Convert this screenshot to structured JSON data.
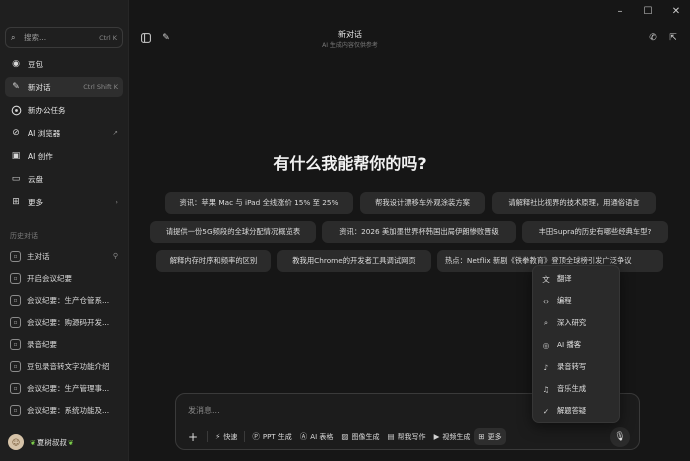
{
  "window": {
    "controls": [
      {
        "name": "minimize-button",
        "glyph": "–"
      },
      {
        "name": "maximize-button",
        "glyph": "☐"
      },
      {
        "name": "close-button",
        "glyph": "✕"
      }
    ]
  },
  "sidebar": {
    "search": {
      "placeholder": "搜索...",
      "shortcut": "Ctrl K"
    },
    "nav": [
      {
        "name": "nav-doubao",
        "icon": "doubao-logo-icon",
        "glyph": "◉",
        "label": "豆包",
        "right": ""
      },
      {
        "name": "nav-new-chat",
        "icon": "edit-icon",
        "glyph": "✎",
        "label": "新对话",
        "right": "Ctrl Shift K",
        "active": true
      },
      {
        "name": "nav-new-task",
        "icon": "task-icon",
        "glyph": "",
        "label": "新办公任务",
        "right": ""
      },
      {
        "name": "nav-ai-browser",
        "icon": "compass-icon",
        "glyph": "⊘",
        "label": "AI 浏览器",
        "right": "↗"
      },
      {
        "name": "nav-ai-create",
        "icon": "image-icon",
        "glyph": "▣",
        "label": "AI 创作",
        "right": ""
      },
      {
        "name": "nav-cloud",
        "icon": "folder-icon",
        "glyph": "▭",
        "label": "云盘",
        "right": ""
      },
      {
        "name": "nav-more",
        "icon": "grid-icon",
        "glyph": "⊞",
        "label": "更多",
        "right": "›"
      }
    ],
    "history_title": "历史对话",
    "history": [
      {
        "label": "主对话",
        "pinned": true
      },
      {
        "label": "开启会议纪要",
        "pinned": false
      },
      {
        "label": "会议纪要：生产仓管系...",
        "pinned": false
      },
      {
        "label": "会议纪要：购源码开发...",
        "pinned": false
      },
      {
        "label": "录音纪要",
        "pinned": false
      },
      {
        "label": "豆包录音转文字功能介绍",
        "pinned": false
      },
      {
        "label": "会议纪要：生产管理事...",
        "pinned": false
      },
      {
        "label": "会议纪要：系统功能及...",
        "pinned": false
      }
    ],
    "user": {
      "name": "夏树叔叔"
    }
  },
  "header": {
    "title": "新对话",
    "subtitle": "AI 生成内容仅供参考"
  },
  "main": {
    "heading": "有什么我能帮你的吗?",
    "chips": [
      "资讯：苹果 Mac 与 iPad 全线涨价 15% 至 25%",
      "帮我设计漂移车外观涂装方案",
      "请解释社比视界的技术原理，用通俗语言",
      "请提供一份5G频段的全球分配情况概览表",
      "资讯：2026 美加墨世界杯韩国出局伊朗惨败晋级",
      "丰田Supra的历史有哪些经典车型?",
      "解释内存时序和频率的区别",
      "教我用Chrome的开发者工具调试网页",
      "热点：Netflix 新剧《铁拳教育》登顶全球榜引发广泛争议"
    ]
  },
  "input": {
    "placeholder": "发消息...",
    "tools": [
      {
        "name": "tool-quick",
        "icon": "lightning-icon",
        "glyph": "⚡",
        "label": "快速"
      },
      {
        "name": "tool-ppt",
        "icon": "ppt-icon",
        "glyph": "Ⓟ",
        "label": "PPT 生成"
      },
      {
        "name": "tool-ai-table",
        "icon": "table-icon",
        "glyph": "Ⓐ",
        "label": "AI 表格"
      },
      {
        "name": "tool-image",
        "icon": "image-icon",
        "glyph": "▨",
        "label": "图像生成"
      },
      {
        "name": "tool-writing",
        "icon": "pen-icon",
        "glyph": "▤",
        "label": "帮我写作"
      },
      {
        "name": "tool-video",
        "icon": "video-icon",
        "glyph": "▶",
        "label": "视频生成"
      },
      {
        "name": "tool-more",
        "icon": "grid-icon",
        "glyph": "⊞",
        "label": "更多"
      }
    ]
  },
  "popup_menu": {
    "items": [
      {
        "name": "menu-translate",
        "icon": "translate-icon",
        "glyph": "文",
        "label": "翻译"
      },
      {
        "name": "menu-code",
        "icon": "code-icon",
        "glyph": "‹›",
        "label": "编程"
      },
      {
        "name": "menu-research",
        "icon": "telescope-icon",
        "glyph": "⌕",
        "label": "深入研究"
      },
      {
        "name": "menu-podcast",
        "icon": "podcast-icon",
        "glyph": "◎",
        "label": "AI 播客"
      },
      {
        "name": "menu-transcribe",
        "icon": "mic-icon",
        "glyph": "♪",
        "label": "录音转写"
      },
      {
        "name": "menu-music",
        "icon": "music-icon",
        "glyph": "♫",
        "label": "音乐生成"
      },
      {
        "name": "menu-solve",
        "icon": "solve-icon",
        "glyph": "✓",
        "label": "解题答疑"
      }
    ]
  }
}
